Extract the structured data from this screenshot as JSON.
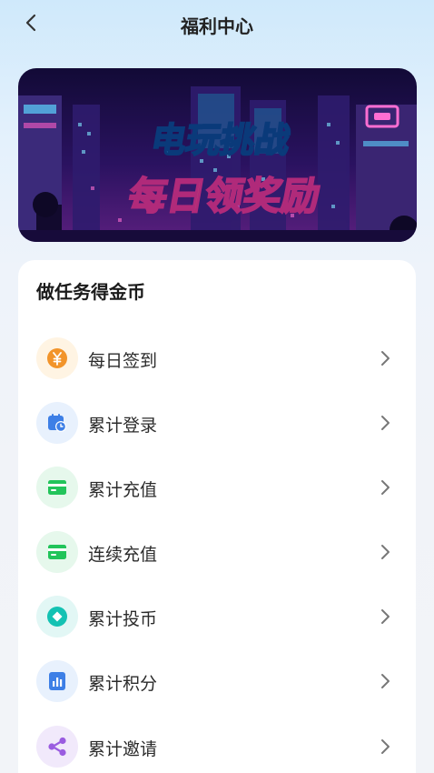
{
  "header": {
    "title": "福利中心",
    "back_icon": "chevron-left-icon"
  },
  "banner": {
    "headline": "电玩挑战",
    "subline": "每日领奖励",
    "theme": "pixel-art neon city"
  },
  "tasks_card": {
    "title": "做任务得金币",
    "items": [
      {
        "label": "每日签到",
        "icon": "coin-yen-icon",
        "color": "#f2942a",
        "bg": "#fff4e3"
      },
      {
        "label": "累计登录",
        "icon": "calendar-clock-icon",
        "color": "#3d7fe6",
        "bg": "#e8f1fd"
      },
      {
        "label": "累计充值",
        "icon": "card-icon",
        "color": "#22c45a",
        "bg": "#e6f8ec"
      },
      {
        "label": "连续充值",
        "icon": "card-icon",
        "color": "#22c45a",
        "bg": "#e6f8ec"
      },
      {
        "label": "累计投币",
        "icon": "coin-diamond-icon",
        "color": "#14c2b3",
        "bg": "#e2f7f5"
      },
      {
        "label": "累计积分",
        "icon": "bar-chart-icon",
        "color": "#3d7fe6",
        "bg": "#e8f1fd"
      },
      {
        "label": "累计邀请",
        "icon": "share-icon",
        "color": "#9a5ce0",
        "bg": "#f1e9fb"
      }
    ]
  }
}
